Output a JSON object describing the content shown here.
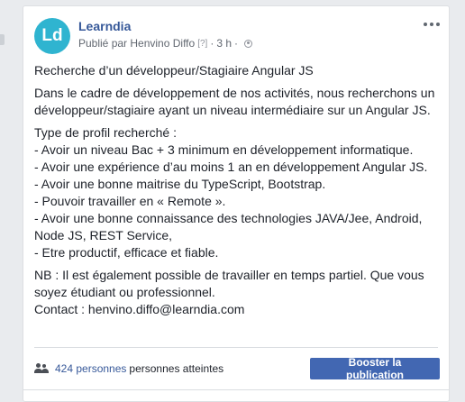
{
  "post": {
    "page_name": "Learndia",
    "avatar_text": "Ld",
    "published_by": "Publié par Henvino Diffo",
    "help_marker": "[?]",
    "separator": "·",
    "time": "3 h",
    "separator2": "·",
    "title_line": "Recherche d’un développeur/Stagiaire Angular JS",
    "intro_lines": [
      "Dans le cadre de développement de nos activités, nous recherchons un",
      "développeur/stagiaire ayant un niveau intermédiaire sur un Angular JS."
    ],
    "profile_lines": [
      "Type de profil recherché :",
      "- Avoir un niveau Bac + 3 minimum en développement informatique.",
      "- Avoir une expérience d’au moins 1 an en développement Angular JS.",
      "- Avoir une bonne maitrise du TypeScript, Bootstrap.",
      "- Pouvoir travailler en « Remote ».",
      "- Avoir une bonne connaissance des technologies JAVA/Jee, Android,",
      "Node JS, REST Service,",
      "- Etre productif, efficace et fiable."
    ],
    "nb_lines": [
      "NB : Il est également possible de travailler en temps partiel. Que vous",
      "soyez étudiant ou professionnel.",
      "Contact : henvino.diffo@learndia.com"
    ]
  },
  "footer": {
    "reach_count": "424 personnes",
    "reach_label": "personnes atteintes",
    "boost_label": "Booster la publication"
  },
  "colors": {
    "avatar_bg": "#2fb4d0",
    "link": "#365899",
    "button": "#4267b2"
  },
  "icons": [
    "more-options-icon",
    "globe-icon",
    "people-icon"
  ]
}
